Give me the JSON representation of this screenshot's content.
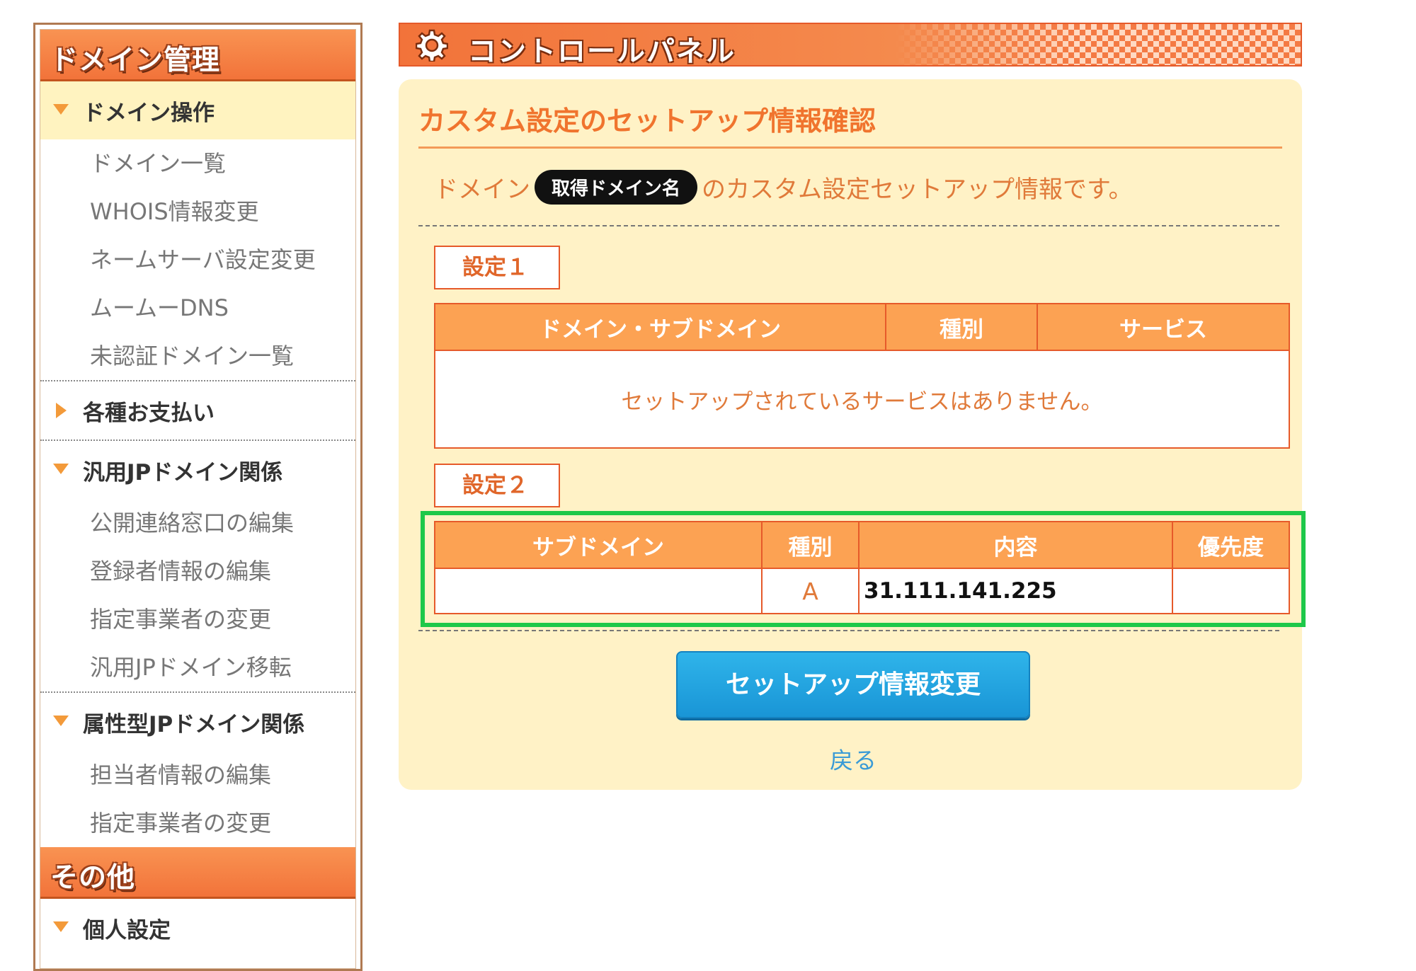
{
  "sidebar": {
    "domain_header": "ドメイン管理",
    "groups": [
      {
        "label": "ドメイン操作",
        "items": [
          "ドメイン一覧",
          "WHOIS情報変更",
          "ネームサーバ設定変更",
          "ムームーDNS",
          "未認証ドメイン一覧"
        ]
      },
      {
        "label": "各種お支払い",
        "items": []
      },
      {
        "label": "汎用JPドメイン関係",
        "items": [
          "公開連絡窓口の編集",
          "登録者情報の編集",
          "指定事業者の変更",
          "汎用JPドメイン移転"
        ]
      },
      {
        "label": "属性型JPドメイン関係",
        "items": [
          "担当者情報の編集",
          "指定事業者の変更"
        ]
      }
    ],
    "other_header": "その他",
    "other_groups": [
      {
        "label": "個人設定"
      }
    ]
  },
  "banner": {
    "title": "コントロールパネル",
    "icon": "gear-icon"
  },
  "panel": {
    "title": "カスタム設定のセットアップ情報確認",
    "intro_prefix": "ドメイン",
    "domain_placeholder": "取得ドメイン名",
    "intro_suffix": "のカスタム設定セットアップ情報です。"
  },
  "setting1": {
    "label": "設定１",
    "headers": [
      "ドメイン・サブドメイン",
      "種別",
      "サービス"
    ],
    "empty_message": "セットアップされているサービスはありません。"
  },
  "setting2": {
    "label": "設定２",
    "headers": [
      "サブドメイン",
      "種別",
      "内容",
      "優先度"
    ],
    "rows": [
      {
        "subdomain": "",
        "type": "A",
        "content": "31.111.141.225",
        "priority": ""
      }
    ]
  },
  "actions": {
    "change_button": "セットアップ情報変更",
    "back_link": "戻る"
  },
  "colors": {
    "accent": "#f2733a",
    "panel_bg": "#fff2c6",
    "button": "#1995d6",
    "highlight": "#1ec84a"
  }
}
